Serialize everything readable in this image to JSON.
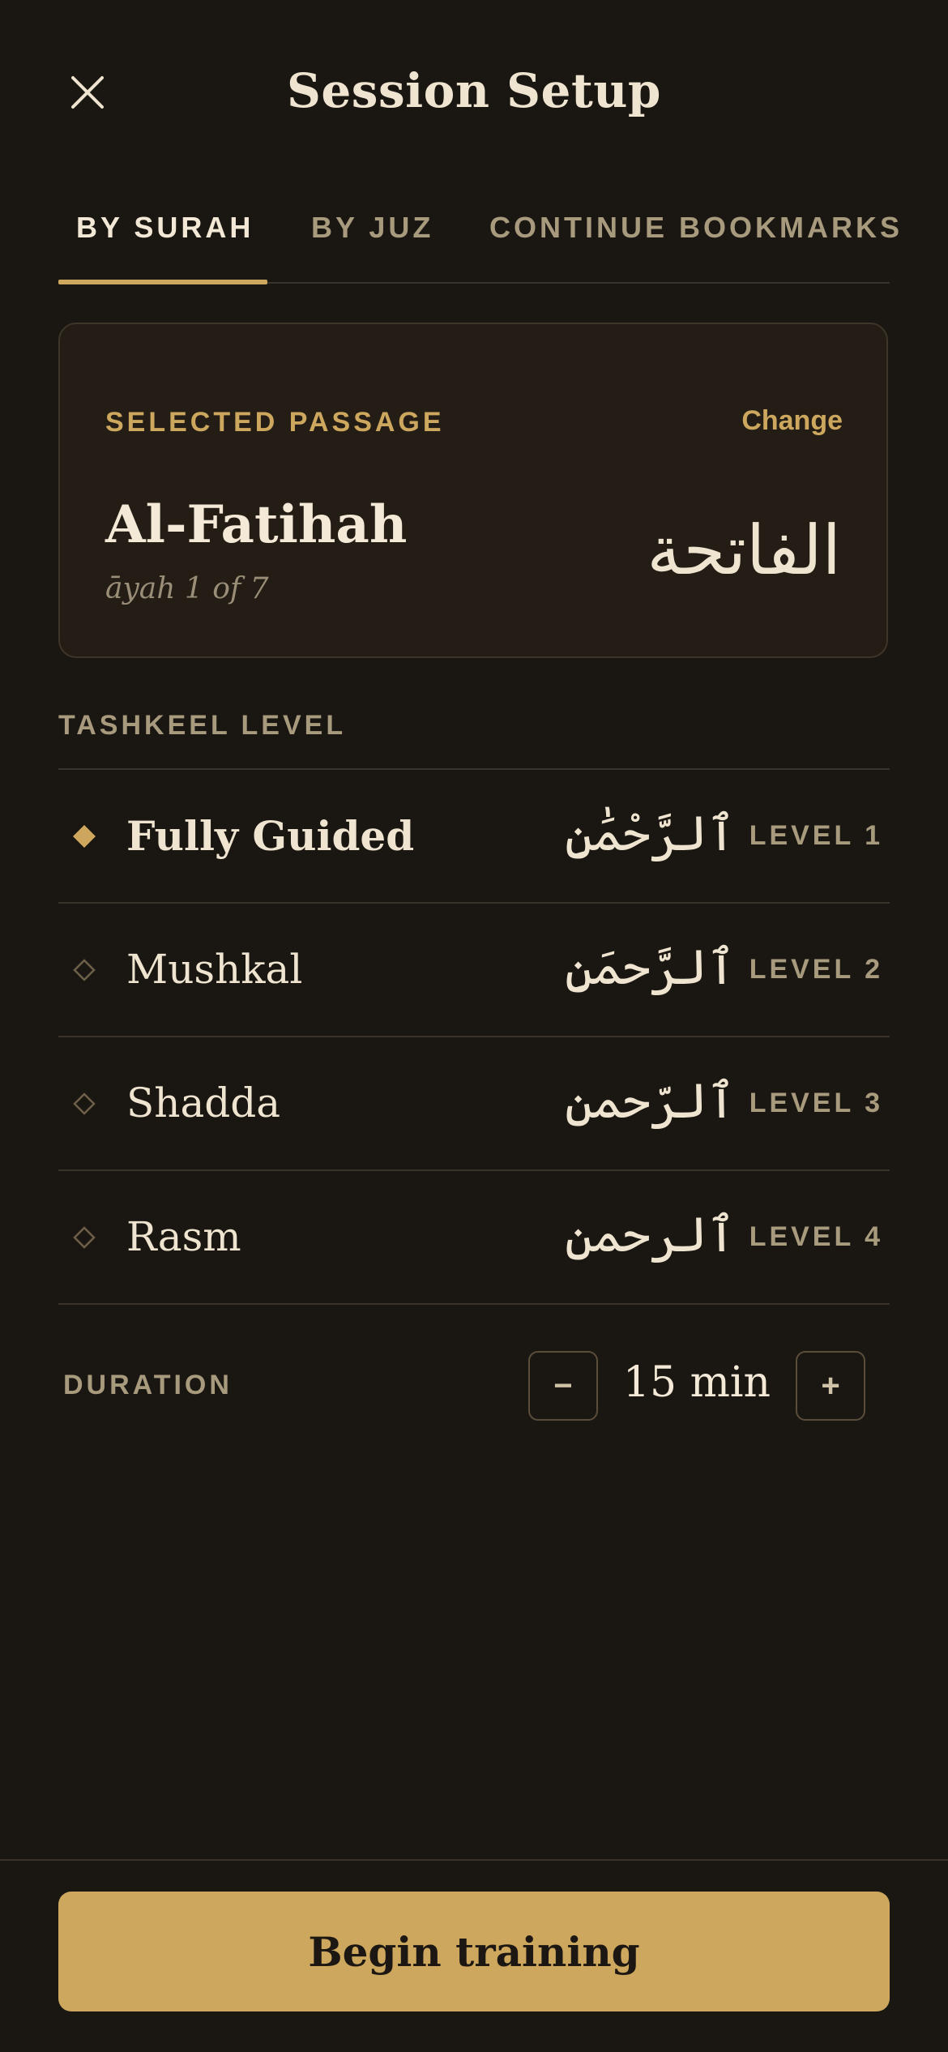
{
  "header": {
    "title": "Session Setup",
    "close_icon": "close-icon"
  },
  "tabs": [
    {
      "label": "BY SURAH",
      "active": true
    },
    {
      "label": "BY JUZ",
      "active": false
    },
    {
      "label": "CONTINUE BOOKMARKS",
      "active": false
    }
  ],
  "passage": {
    "label": "SELECTED PASSAGE",
    "change_label": "Change",
    "name": "Al-Fatihah",
    "ayah_info": "āyah 1 of 7",
    "arabic": "الفاتحة"
  },
  "tashkeel": {
    "label": "TASHKEEL LEVEL",
    "levels": [
      {
        "name": "Fully Guided",
        "arabic": "ٱلرَّحْمَٰنِ",
        "tag": "LEVEL 1",
        "selected": true
      },
      {
        "name": "Mushkal",
        "arabic": "ٱلرَّحمَنِ",
        "tag": "LEVEL 2",
        "selected": false
      },
      {
        "name": "Shadda",
        "arabic": "ٱلرّحمن",
        "tag": "LEVEL 3",
        "selected": false
      },
      {
        "name": "Rasm",
        "arabic": "ٱلرحمن",
        "tag": "LEVEL 4",
        "selected": false
      }
    ]
  },
  "duration": {
    "label": "DURATION",
    "value": "15 min",
    "minus_label": "−",
    "plus_label": "+"
  },
  "footer": {
    "begin_label": "Begin training"
  },
  "colors": {
    "background": "#1a1713",
    "accent": "#cda75e",
    "card": "#231d16",
    "text": "#efe4cf",
    "muted": "#a89a7d"
  }
}
